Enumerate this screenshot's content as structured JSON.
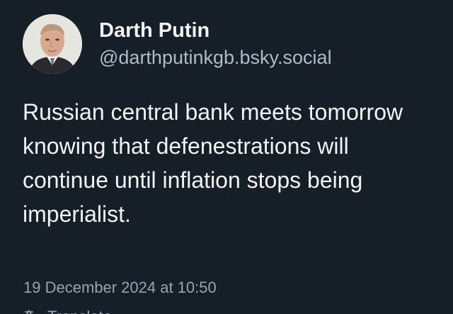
{
  "post": {
    "author": {
      "display_name": "Darth Putin",
      "handle": "@darthputinkgb.bsky.social",
      "avatar_icon": "profile-photo"
    },
    "text": "Russian central bank meets tomorrow knowing that defenestrations will continue until inflation stops being imperialist.",
    "timestamp": "19 December 2024 at 10:50",
    "translate_label": "Translate",
    "translate_icon": "translate-icon"
  },
  "colors": {
    "background": "#161e27",
    "text_primary": "#f1f3f5",
    "text_secondary": "#93a5b7"
  }
}
